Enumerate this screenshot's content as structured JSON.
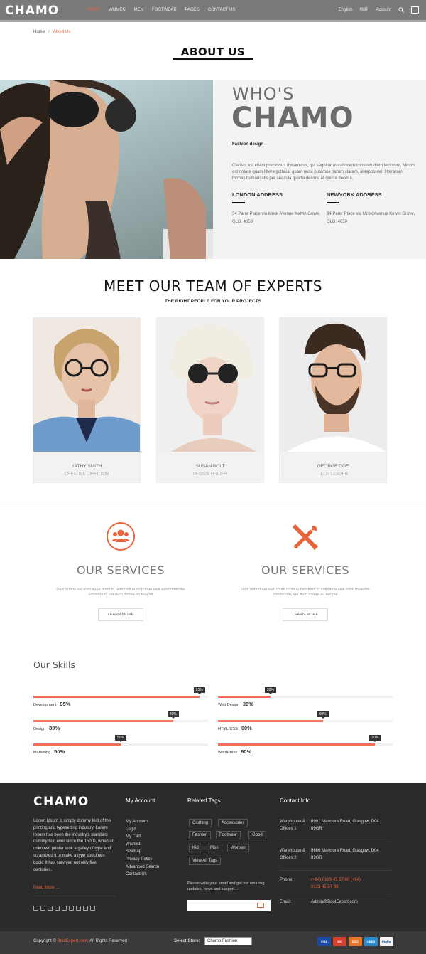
{
  "header": {
    "logo": "CHAMO",
    "nav": [
      "HOME",
      "WOMEN",
      "MEN",
      "FOOTWEAR",
      "PAGES",
      "CONTACT US"
    ],
    "language": "English",
    "currency": "GBP",
    "account": "Account"
  },
  "breadcrumb": {
    "home": "Home",
    "sep": "/",
    "current": "About Us"
  },
  "page_title": "ABOUT US",
  "hero": {
    "whos": "WHO'S",
    "chamo": "CHAMO",
    "subtitle": "Fashion design",
    "text": "Claritas est etiam processus dynamicus, qui sequitur mutationem consuetudium lectorum. Mirum est notare quam littera gothica, quam nunc putamus parum claram, anteposuerit litterarum formas humanitatis per seacula quarta decima et quinta decima.",
    "london_h": "LONDON ADDRESS",
    "london_t": "34 Parer Place via Musk Avenue Kelvin Grove, QLD, 4059",
    "ny_h": "NEWYORK ADDRESS",
    "ny_t": "34 Parer Place via Musk Avenue Kelvin Grove, QLD, 4059"
  },
  "team": {
    "title": "MEET OUR TEAM OF EXPERTS",
    "subtitle": "THE RIGHT PEOPLE FOR YOUR PROJECTS",
    "members": [
      {
        "name": "KATHY SMITH",
        "role": "CREATIVE DIRECTOR"
      },
      {
        "name": "SUSAN BOLT",
        "role": "DESIGN LEADER"
      },
      {
        "name": "GEORGE DOE",
        "role": "TECH LEADER"
      }
    ]
  },
  "services": [
    {
      "title": "OUR SERVICES",
      "text": "Duis autem vel eum iriure dolor in hendrerit in vulputate velit esse molestie consequat, vel illum dolore eu feugiat",
      "button": "LEARN MORE",
      "icon": "users-icon"
    },
    {
      "title": "OUR SERVICES",
      "text": "Duis autem vel eum iriure dolor in hendrerit in vulputate velit esse molestie consequat, vel illum dolore eu feugiat",
      "button": "LEARN MORE",
      "icon": "tools-icon"
    }
  ],
  "skills": {
    "title": "Our Skills",
    "items": [
      {
        "label": "Development",
        "value": 95,
        "text": "95%"
      },
      {
        "label": "Web Design",
        "value": 30,
        "text": "30%"
      },
      {
        "label": "Design",
        "value": 80,
        "text": "80%"
      },
      {
        "label": "HTML/CSS",
        "value": 60,
        "text": "60%"
      },
      {
        "label": "Marketing",
        "value": 50,
        "text": "50%"
      },
      {
        "label": "WordPress",
        "value": 90,
        "text": "90%"
      }
    ]
  },
  "footer": {
    "logo": "CHAMO",
    "about": "Lorem Ipsum is simply dummy text of the printing and typesetting industry. Lorem Ipsum has been the industry's standard dummy text ever since the 1500s, when an unknown printer took a galley of type and scrambled it to make a type specimen book. It has survived not only five centuries.",
    "read_more": "Read More →",
    "account_h": "My Account",
    "account_links": [
      "My Account",
      "Login",
      "My Cart",
      "Wishlist",
      "Sitemap",
      "Privacy Policy",
      "Advanced Search",
      "Contact Us"
    ],
    "tags_h": "Related Tags",
    "tags": [
      "Clothing",
      "Accessories",
      "Fashion",
      "Footwear",
      "Good",
      "Kid",
      "Men",
      "Women",
      "View All Tags"
    ],
    "subscribe_text": "Please write your email and get our amazing updates, news and support...",
    "contact_h": "Contact Info",
    "wh1_lbl": "Warehouse & Offices 1",
    "wh1_val": "8901 Marmora Road, Glasgow, D04 89GR",
    "wh2_lbl": "Warehouse & Offices 2",
    "wh2_val": "8666 Marmora Road, Glasgow, D04 89GR",
    "phone_lbl": "Phone:",
    "phone_val": "(+84) 0123 45 67 89 (+84) 0123 45 67 89",
    "email_lbl": "Email:",
    "email_val": "Admin@BootExpert.com"
  },
  "bottom": {
    "copy_pre": "Copyright ©",
    "brand": "BootExpert.com",
    "copy_post": ". All Rights Reserved",
    "store_lbl": "Select Store:",
    "store_val": "Chamo Fashion",
    "payments": [
      "VISA",
      "MC",
      "DISC",
      "AMEX",
      "PayPal"
    ]
  },
  "colors": {
    "accent": "#e8643c",
    "skill_bar": "#f26f5a",
    "header": "#7a7a7a",
    "footer": "#2b2b2b"
  }
}
